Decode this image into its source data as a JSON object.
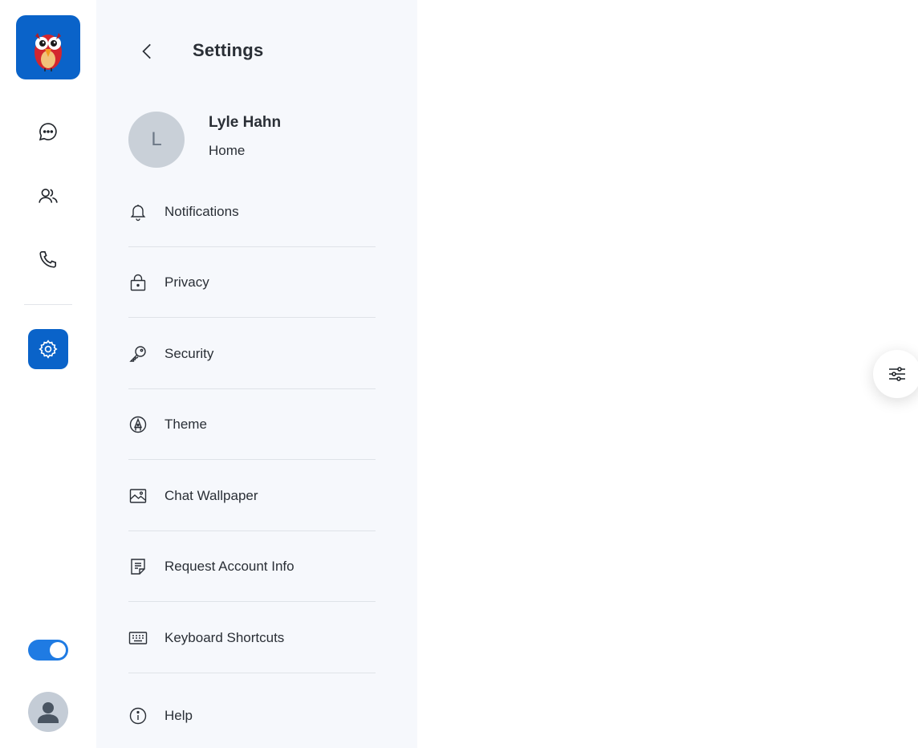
{
  "rail": {
    "logo_icon": "owl-mascot-icon",
    "nav": [
      {
        "name": "chats",
        "icon": "chat-bubble-icon"
      },
      {
        "name": "contacts",
        "icon": "users-icon"
      },
      {
        "name": "calls",
        "icon": "phone-icon"
      },
      {
        "name": "settings",
        "icon": "gear-icon",
        "active": true
      }
    ],
    "theme_toggle_on": true,
    "user_avatar_icon": "person-icon"
  },
  "settings": {
    "title": "Settings",
    "profile": {
      "initial": "L",
      "name": "Lyle Hahn",
      "status": "Home"
    },
    "menu": [
      {
        "label": "Notifications",
        "icon": "bell-icon"
      },
      {
        "label": "Privacy",
        "icon": "lock-icon"
      },
      {
        "label": "Security",
        "icon": "key-icon"
      },
      {
        "label": "Theme",
        "icon": "pen-nib-icon"
      },
      {
        "label": "Chat Wallpaper",
        "icon": "image-icon"
      },
      {
        "label": "Request Account Info",
        "icon": "document-icon"
      },
      {
        "label": "Keyboard Shortcuts",
        "icon": "keyboard-icon"
      },
      {
        "label": "Help",
        "icon": "info-icon"
      }
    ]
  },
  "fab_icon": "sliders-icon",
  "colors": {
    "accent": "#0a63c9",
    "toggle": "#1f7be3",
    "panel_bg": "#f6f8fc",
    "text": "#2a2f36"
  }
}
